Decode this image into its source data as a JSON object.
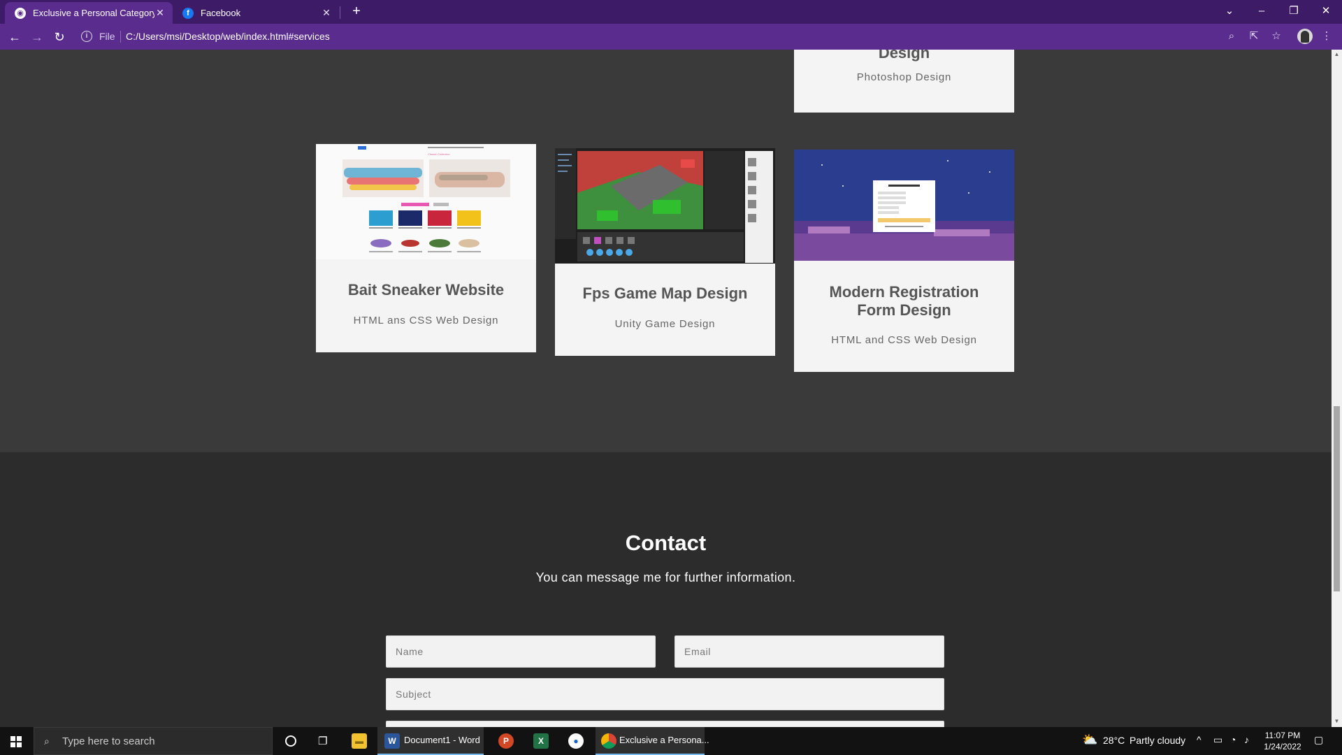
{
  "browser": {
    "tabs": [
      {
        "title": "Exclusive a Personal Category Bo",
        "active": true,
        "favicon": "globe-icon"
      },
      {
        "title": "Facebook",
        "active": false,
        "favicon": "facebook-icon"
      }
    ],
    "scheme": "File",
    "url": "C:/Users/msi/Desktop/web/index.html#services",
    "accent": "#5a2c8e"
  },
  "portfolio": {
    "top_card": {
      "title": "Design",
      "subtitle": "Photoshop Design"
    },
    "cards": [
      {
        "title": "Bait Sneaker Website",
        "subtitle": "HTML ans CSS Web Design"
      },
      {
        "title": "Fps Game Map Design",
        "subtitle": "Unity Game Design"
      },
      {
        "title": "Modern Registration Form Design",
        "subtitle": "HTML and CSS Web Design"
      }
    ]
  },
  "contact": {
    "heading": "Contact",
    "lead": "You can message me for further information.",
    "name_placeholder": "Name",
    "email_placeholder": "Email",
    "subject_placeholder": "Subject"
  },
  "taskbar": {
    "search_placeholder": "Type here to search",
    "apps": [
      {
        "label": "Document1 - Word",
        "icon": "word-icon"
      },
      {
        "label": "Exclusive a Persona...",
        "icon": "chrome-icon"
      }
    ],
    "weather": {
      "temp": "28°C",
      "condition": "Partly cloudy"
    },
    "time": "11:07 PM",
    "date": "1/24/2022"
  }
}
